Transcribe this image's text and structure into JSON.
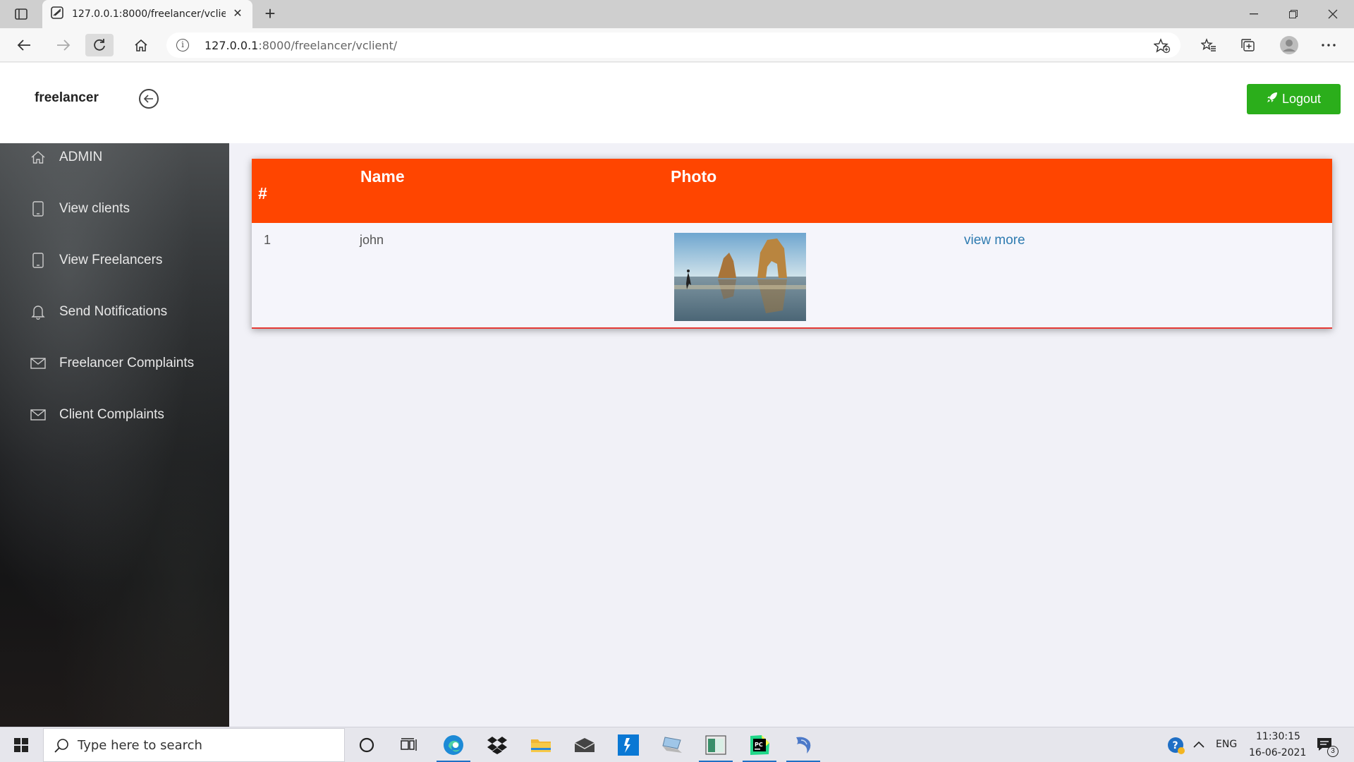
{
  "browser": {
    "tab_title": "127.0.0.1:8000/freelancer/vclient/",
    "url_host": "127.0.0.1",
    "url_path": ":8000/freelancer/vclient/"
  },
  "header": {
    "brand": "freelancer",
    "logout_label": "Logout"
  },
  "sidebar": {
    "items": [
      {
        "label": "ADMIN",
        "icon": "home-icon"
      },
      {
        "label": "View clients",
        "icon": "tablet-icon"
      },
      {
        "label": "View Freelancers",
        "icon": "tablet-icon"
      },
      {
        "label": "Send Notifications",
        "icon": "bell-icon"
      },
      {
        "label": "Freelancer Complaints",
        "icon": "envelope-icon"
      },
      {
        "label": "Client Complaints",
        "icon": "envelope-icon"
      }
    ]
  },
  "table": {
    "headers": [
      "#",
      "Name",
      "Photo",
      ""
    ],
    "rows": [
      {
        "num": "1",
        "name": "john",
        "photo": "beach-arch-photo",
        "action": "view more"
      }
    ]
  },
  "taskbar": {
    "search_placeholder": "Type here to search",
    "lang": "ENG",
    "time": "11:30:15",
    "date": "16-06-2021",
    "notifications": "3"
  },
  "colors": {
    "table_header": "#ff4500",
    "logout": "#2bae1b",
    "link": "#2e7bb0"
  }
}
